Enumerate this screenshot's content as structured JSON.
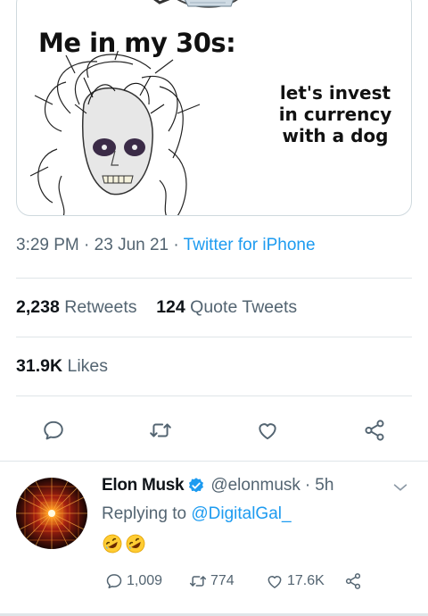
{
  "meme": {
    "heading": "Me in my 30s:",
    "caption_lines": [
      "let's invest",
      "in currency",
      "with a dog"
    ]
  },
  "tweet_meta": {
    "time": "3:29 PM",
    "date": "23 Jun 21",
    "separator": "·",
    "source": "Twitter for iPhone"
  },
  "stats": {
    "retweets_count": "2,238",
    "retweets_label": "Retweets",
    "quotes_count": "124",
    "quotes_label": "Quote Tweets",
    "likes_count": "31.9K",
    "likes_label": "Likes"
  },
  "actions": [
    "reply-icon",
    "retweet-icon",
    "like-icon",
    "share-icon"
  ],
  "reply": {
    "name": "Elon Musk",
    "handle": "@elonmusk",
    "separator": "·",
    "age": "5h",
    "replying_to_label": "Replying to",
    "replying_to": "@DigitalGal_",
    "emojis": [
      "rolling-on-floor-laughing",
      "rolling-on-floor-laughing"
    ],
    "reply_count": "1,009",
    "retweet_count": "774",
    "like_count": "17.6K"
  },
  "colors": {
    "accent": "#1d9bf0",
    "muted": "#536471",
    "text": "#0f1419",
    "divider": "#dfe5e8"
  }
}
